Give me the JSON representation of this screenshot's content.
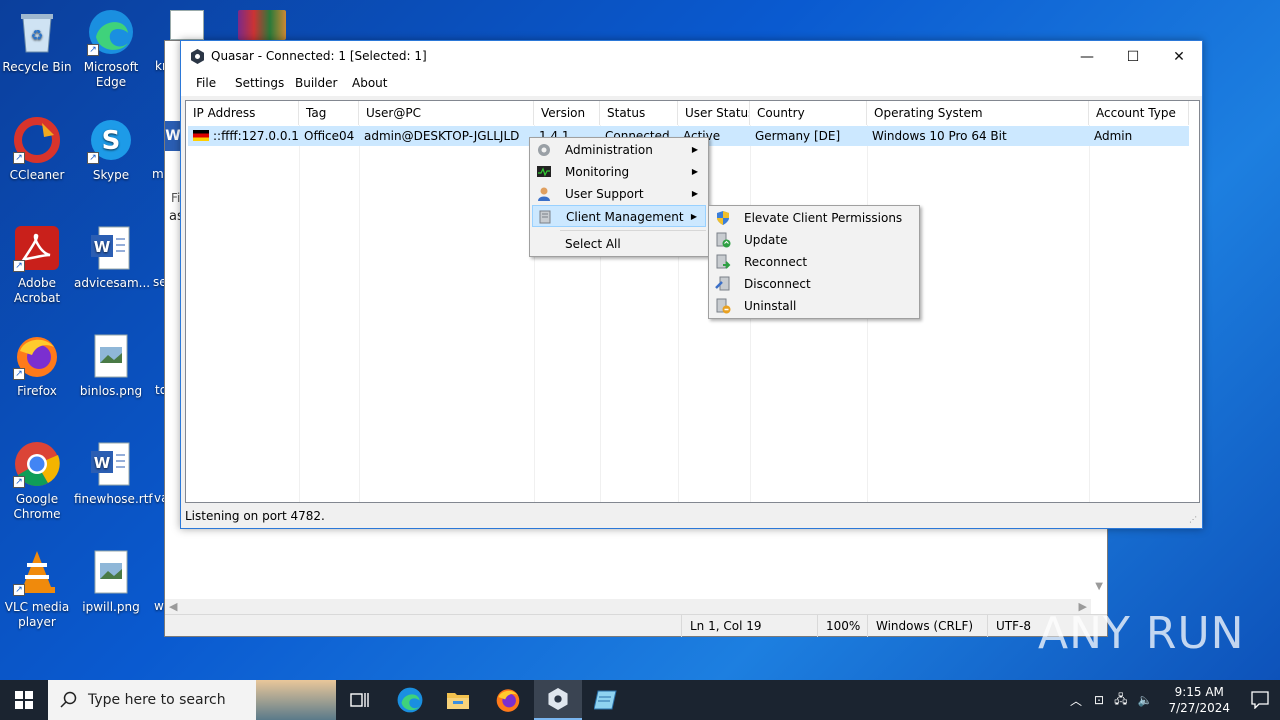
{
  "desktop": {
    "icons": [
      {
        "label": "Recycle Bin",
        "icon": "recycle-bin-icon"
      },
      {
        "label": "Microsoft Edge",
        "icon": "edge-icon"
      },
      {
        "label": "CCleaner",
        "icon": "ccleaner-icon"
      },
      {
        "label": "Skype",
        "icon": "skype-icon"
      },
      {
        "label": "Adobe Acrobat",
        "icon": "acrobat-icon"
      },
      {
        "label": "advicesam...",
        "icon": "word-doc-icon"
      },
      {
        "label": "Firefox",
        "icon": "firefox-icon"
      },
      {
        "label": "binlos.png",
        "icon": "image-file-icon"
      },
      {
        "label": "Google Chrome",
        "icon": "chrome-icon"
      },
      {
        "label": "finewhose.rtf",
        "icon": "word-doc-icon"
      },
      {
        "label": "VLC media player",
        "icon": "vlc-icon"
      },
      {
        "label": "ipwill.png",
        "icon": "image-file-icon"
      }
    ],
    "partial_labels": [
      "know",
      "m",
      "Fi",
      "as",
      "se",
      "to",
      "va",
      "w"
    ]
  },
  "notepad": {
    "status": {
      "position": "Ln 1, Col 19",
      "zoom": "100%",
      "line_ending": "Windows (CRLF)",
      "encoding": "UTF-8"
    }
  },
  "quasar": {
    "title": "Quasar - Connected: 1 [Selected: 1]",
    "menu": [
      "File",
      "Settings",
      "Builder",
      "About"
    ],
    "columns": [
      "IP Address",
      "Tag",
      "User@PC",
      "Version",
      "Status",
      "User Status",
      "Country",
      "Operating System",
      "Account Type"
    ],
    "rows": [
      {
        "ip": "::ffff:127.0.0.1",
        "tag": "Office04",
        "user_pc": "admin@DESKTOP-JGLLJLD",
        "version": "1.4.1",
        "status": "Connected",
        "user_status": "Active",
        "country": "Germany [DE]",
        "os": "Windows 10 Pro 64 Bit",
        "account_type": "Admin"
      }
    ],
    "statusbar": "Listening on port 4782.",
    "context_menu": {
      "items": [
        {
          "label": "Administration",
          "icon": "gear-icon",
          "submenu": true
        },
        {
          "label": "Monitoring",
          "icon": "monitor-icon",
          "submenu": true
        },
        {
          "label": "User Support",
          "icon": "user-icon",
          "submenu": true
        },
        {
          "label": "Client Management",
          "icon": "client-icon",
          "submenu": true,
          "highlighted": true
        },
        {
          "label": "Select All",
          "submenu": false
        }
      ]
    },
    "submenu": {
      "items": [
        {
          "label": "Elevate Client Permissions",
          "icon": "shield-icon"
        },
        {
          "label": "Update",
          "icon": "update-icon"
        },
        {
          "label": "Reconnect",
          "icon": "reconnect-icon"
        },
        {
          "label": "Disconnect",
          "icon": "disconnect-icon"
        },
        {
          "label": "Uninstall",
          "icon": "uninstall-icon"
        }
      ]
    }
  },
  "taskbar": {
    "search_placeholder": "Type here to search",
    "time": "9:15 AM",
    "date": "7/27/2024"
  },
  "watermark": "ANY RUN"
}
